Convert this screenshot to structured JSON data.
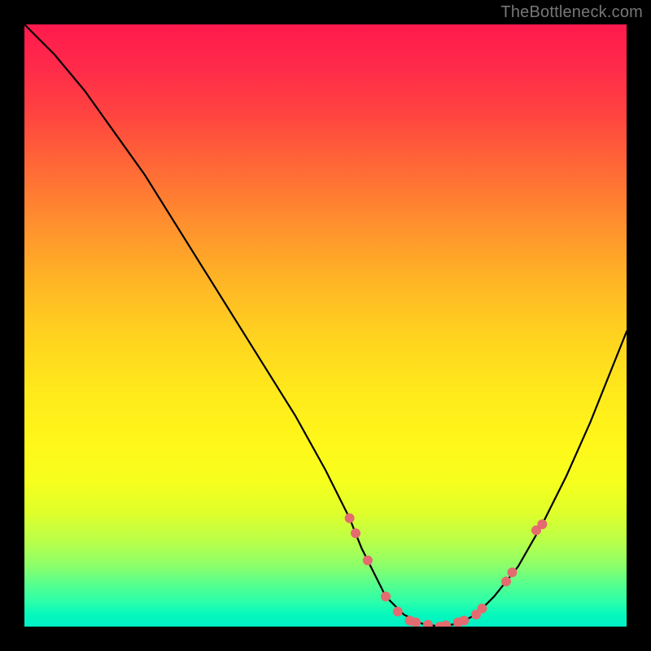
{
  "watermark": "TheBottleneck.com",
  "chart_data": {
    "type": "line",
    "title": "",
    "xlabel": "",
    "ylabel": "",
    "xlim": [
      0,
      100
    ],
    "ylim": [
      0,
      100
    ],
    "grid": false,
    "legend": false,
    "series": [
      {
        "name": "bottleneck-curve",
        "x": [
          0,
          5,
          10,
          15,
          20,
          25,
          30,
          35,
          40,
          45,
          50,
          54,
          56,
          58,
          60,
          63,
          66,
          69,
          72,
          75,
          78,
          82,
          86,
          90,
          94,
          98,
          100
        ],
        "y": [
          100,
          95,
          89,
          82,
          75,
          67,
          59,
          51,
          43,
          35,
          26,
          18,
          13,
          9,
          5,
          2,
          0.5,
          0,
          0.5,
          2,
          5,
          10,
          17,
          25,
          34,
          44,
          49
        ]
      }
    ],
    "markers": {
      "name": "data-points",
      "color": "#e46b6f",
      "radius_px": 6,
      "points": [
        {
          "x": 54,
          "y": 18
        },
        {
          "x": 55,
          "y": 15.5
        },
        {
          "x": 57,
          "y": 11
        },
        {
          "x": 60,
          "y": 5
        },
        {
          "x": 62,
          "y": 2.5
        },
        {
          "x": 64,
          "y": 1
        },
        {
          "x": 65,
          "y": 0.7
        },
        {
          "x": 67,
          "y": 0.3
        },
        {
          "x": 69,
          "y": 0
        },
        {
          "x": 70,
          "y": 0.2
        },
        {
          "x": 72,
          "y": 0.7
        },
        {
          "x": 73,
          "y": 1
        },
        {
          "x": 75,
          "y": 2
        },
        {
          "x": 76,
          "y": 3
        },
        {
          "x": 80,
          "y": 7.5
        },
        {
          "x": 81,
          "y": 9
        },
        {
          "x": 85,
          "y": 16
        },
        {
          "x": 86,
          "y": 17
        }
      ]
    },
    "gradient_stops": [
      {
        "pos": 0,
        "color": "#ff1a4d"
      },
      {
        "pos": 50,
        "color": "#ffd31f"
      },
      {
        "pos": 75,
        "color": "#f6ff1e"
      },
      {
        "pos": 100,
        "color": "#00f0c6"
      }
    ]
  }
}
